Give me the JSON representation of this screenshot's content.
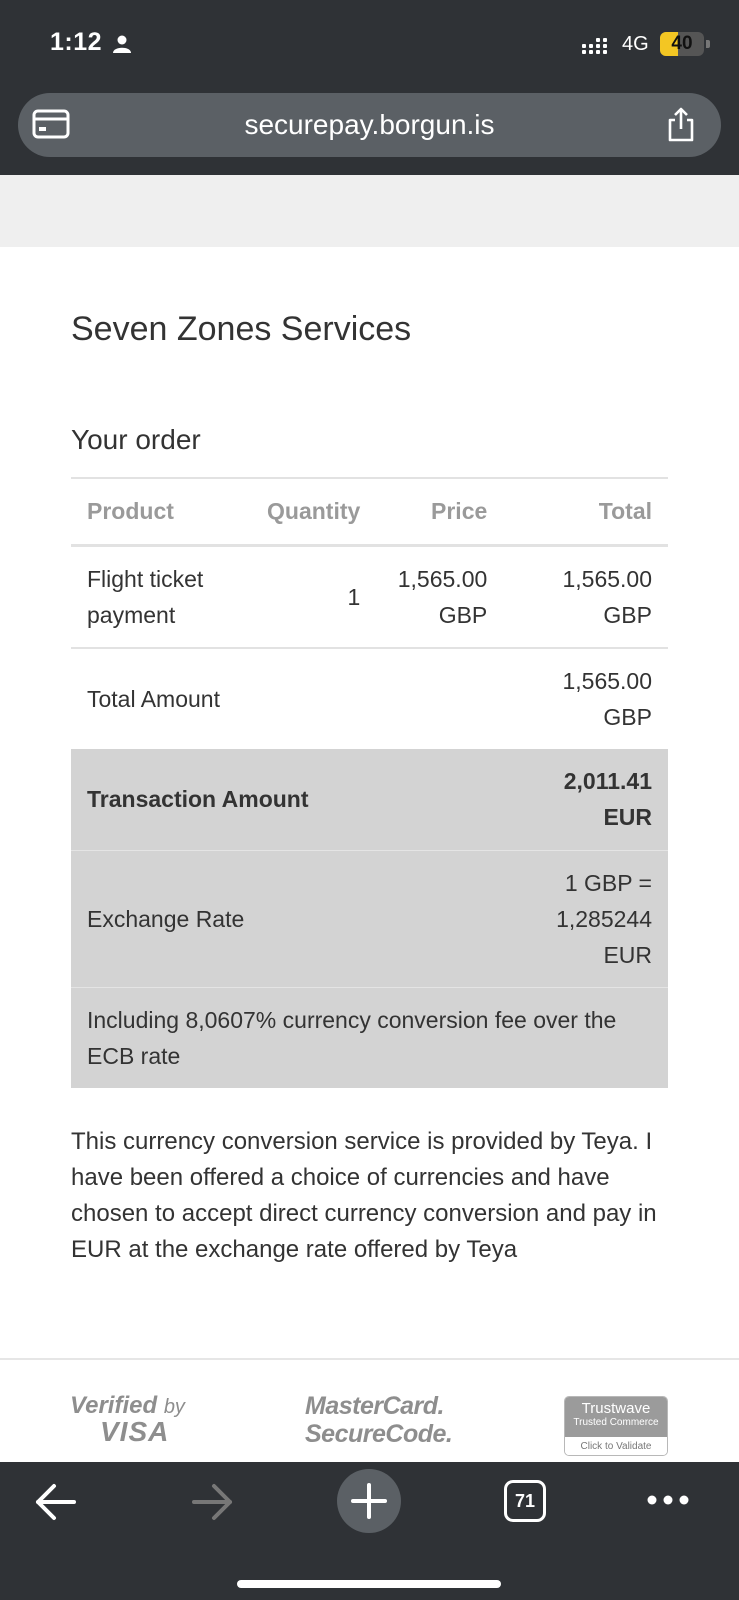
{
  "status_bar": {
    "time": "1:12",
    "network": "4G",
    "battery": "40",
    "battery_level": 0.4
  },
  "url_bar": {
    "url": "securepay.borgun.is"
  },
  "merchant_name": "Seven Zones Services",
  "order": {
    "heading": "Your order",
    "columns": [
      "Product",
      "Quantity",
      "Price",
      "Total"
    ],
    "items": [
      {
        "product": "Flight ticket payment",
        "quantity": "1",
        "price": "1,565.00 GBP",
        "total": "1,565.00 GBP"
      }
    ],
    "total_label": "Total Amount",
    "total_value": "1,565.00 GBP",
    "transaction_label": "Transaction Amount",
    "transaction_value": "2,011.41 EUR",
    "rate_label": "Exchange Rate",
    "rate_value": "1 GBP = 1,285244 EUR",
    "fee_note": "Including 8,0607% currency conversion fee over the ECB rate"
  },
  "disclaimer": "This currency conversion service is provided by Teya. I have been offered a choice of currencies and have chosen to accept direct currency conversion and pay in EUR at the exchange rate offered by Teya",
  "logos": {
    "visa_line1": "Verified",
    "visa_by": "by",
    "visa_line2": "VISA",
    "mastercard_line1": "MasterCard.",
    "mastercard_line2": "SecureCode.",
    "trustwave_title": "Trustwave",
    "trustwave_sub": "Trusted Commerce",
    "trustwave_cta": "Click to Validate"
  },
  "toolbar": {
    "tab_count": "71"
  },
  "colors": {
    "chrome": "#2f3236",
    "url_bar": "#5b6065",
    "highlight_rows": "#d3d3d3",
    "battery": "#f3c623"
  }
}
